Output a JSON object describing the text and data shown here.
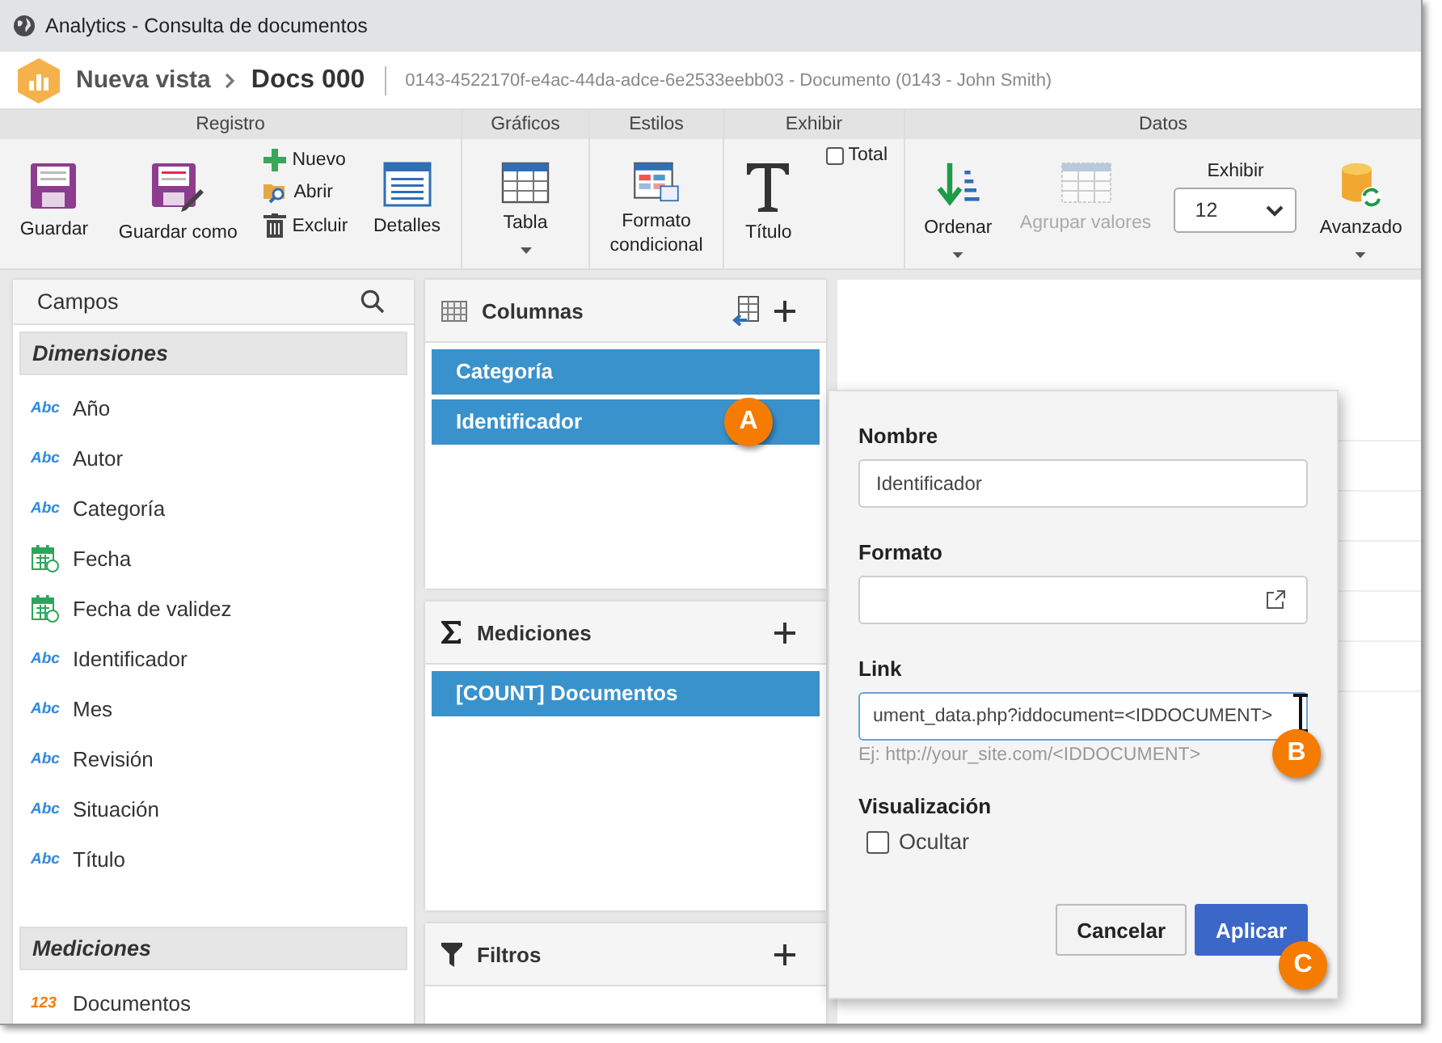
{
  "window": {
    "title": "Analytics - Consulta de documentos"
  },
  "header": {
    "breadcrumb": [
      "Nueva vista",
      "Docs 000"
    ],
    "record": "0143-4522170f-e4ac-44da-adce-6e2533eebb03 - Documento (0143 - John Smith)"
  },
  "ribbon": {
    "groups": [
      {
        "label": "Registro",
        "items": [
          {
            "kind": "large",
            "label": "Guardar",
            "dropdown": false,
            "disabled": false
          },
          {
            "kind": "large",
            "label": "Guardar como",
            "dropdown": false,
            "disabled": false
          },
          {
            "kind": "stack",
            "buttons": [
              {
                "label": "Nuevo"
              },
              {
                "label": "Abrir"
              },
              {
                "label": "Excluir"
              }
            ]
          },
          {
            "kind": "large",
            "label": "Detalles",
            "dropdown": false,
            "disabled": false
          }
        ]
      },
      {
        "label": "Gráficos",
        "items": [
          {
            "kind": "large",
            "label": "Tabla",
            "dropdown": true,
            "disabled": false
          }
        ]
      },
      {
        "label": "Estilos",
        "items": [
          {
            "kind": "large",
            "label": "Formato condicional",
            "dropdown": false,
            "disabled": false
          }
        ]
      },
      {
        "label": "Exhibir",
        "items": [
          {
            "kind": "large",
            "label": "Título",
            "dropdown": false,
            "disabled": false
          },
          {
            "kind": "checkbox",
            "label": "Total",
            "checked": false
          }
        ]
      },
      {
        "label": "Datos",
        "items": [
          {
            "kind": "large",
            "label": "Ordenar",
            "dropdown": true,
            "disabled": false
          },
          {
            "kind": "large",
            "label": "Agrupar valores",
            "dropdown": false,
            "disabled": true
          },
          {
            "kind": "select",
            "label": "Exhibir",
            "value": "12"
          },
          {
            "kind": "large",
            "label": "Avanzado",
            "dropdown": true,
            "disabled": false
          }
        ]
      }
    ]
  },
  "fields_panel": {
    "title": "Campos",
    "sections": [
      {
        "title": "Dimensiones",
        "fields": [
          {
            "kind": "text",
            "type_label": "Abc",
            "name": "Año"
          },
          {
            "kind": "text",
            "type_label": "Abc",
            "name": "Autor"
          },
          {
            "kind": "text",
            "type_label": "Abc",
            "name": "Categoría"
          },
          {
            "kind": "date",
            "name": "Fecha"
          },
          {
            "kind": "date",
            "name": "Fecha de validez"
          },
          {
            "kind": "text",
            "type_label": "Abc",
            "name": "Identificador"
          },
          {
            "kind": "text",
            "type_label": "Abc",
            "name": "Mes"
          },
          {
            "kind": "text",
            "type_label": "Abc",
            "name": "Revisión"
          },
          {
            "kind": "text",
            "type_label": "Abc",
            "name": "Situación"
          },
          {
            "kind": "text",
            "type_label": "Abc",
            "name": "Título"
          }
        ]
      },
      {
        "title": "Mediciones",
        "fields": [
          {
            "kind": "number",
            "type_label": "123",
            "name": "Documentos"
          }
        ]
      }
    ]
  },
  "cards": [
    {
      "title": "Columnas",
      "items": [
        "Categoría",
        "Identificador"
      ]
    },
    {
      "title": "Mediciones",
      "items": [
        "[COUNT] Documentos"
      ]
    },
    {
      "title": "Filtros"
    }
  ],
  "dialog": {
    "name": {
      "label": "Nombre",
      "value": "Identificador"
    },
    "format": {
      "label": "Formato"
    },
    "link": {
      "label": "Link",
      "value": "ument_data.php?iddocument=<IDDOCUMENT>",
      "hint": "Ej: http://your_site.com/<IDDOCUMENT>",
      "focused": true
    },
    "visibility": {
      "label": "Visualización",
      "option": {
        "label": "Ocultar",
        "checked": false
      }
    },
    "buttons": [
      {
        "label": "Cancelar",
        "kind": "secondary"
      },
      {
        "label": "Aplicar",
        "kind": "primary"
      }
    ]
  },
  "callouts": [
    {
      "label": "A"
    },
    {
      "label": "B"
    },
    {
      "label": "C"
    }
  ]
}
